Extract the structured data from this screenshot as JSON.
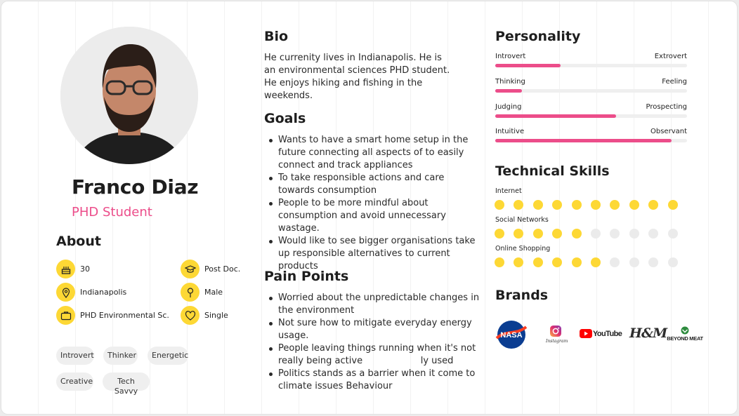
{
  "profile": {
    "name": "Franco Diaz",
    "role": "PHD Student"
  },
  "about": {
    "title": "About",
    "items": [
      {
        "icon": "cake-icon",
        "label": "30"
      },
      {
        "icon": "graduation-cap-icon",
        "label": "Post Doc."
      },
      {
        "icon": "location-pin-icon",
        "label": "Indianapolis"
      },
      {
        "icon": "male-icon",
        "label": "Male"
      },
      {
        "icon": "briefcase-icon",
        "label": "PHD Environmental Sc."
      },
      {
        "icon": "heart-icon",
        "label": "Single"
      }
    ],
    "tags": [
      "Introvert",
      "Thinker",
      "Energetic",
      "Creative",
      "Tech Savvy"
    ]
  },
  "bio": {
    "title": "Bio",
    "text": "He currenity lives in Indianapolis. He is an environmental sciences PHD student. He enjoys hiking and fishing in the weekends."
  },
  "goals": {
    "title": "Goals",
    "items": [
      "Wants to have a smart home setup in the future connecting all aspects of to easily connect and track appliances",
      "To take responsible actions and care towards consumption",
      "People to be more mindful about consumption and avoid unnecessary wastage.",
      "Would like to see bigger organisations take up responsible alternatives to current products"
    ]
  },
  "pain_points": {
    "title": "Pain Points",
    "items": [
      "Worried about the unpredictable changes in the environment",
      "Not sure how to mitigate everyday energy usage.",
      "People leaving things running when it's not really being active                    ly used",
      "Politics stands as a barrier when it come to climate issues Behaviour"
    ]
  },
  "personality": {
    "title": "Personality",
    "traits": [
      {
        "left": "Introvert",
        "right": "Extrovert",
        "value": 0.34
      },
      {
        "left": "Thinking",
        "right": "Feeling",
        "value": 0.14
      },
      {
        "left": "Judging",
        "right": "Prospecting",
        "value": 0.63
      },
      {
        "left": "Intuitive",
        "right": "Observant",
        "value": 0.92
      }
    ]
  },
  "skills": {
    "title": "Technical Skills",
    "max": 10,
    "items": [
      {
        "label": "Internet",
        "level": 10
      },
      {
        "label": "Social Networks",
        "level": 5
      },
      {
        "label": "Online Shopping",
        "level": 6
      }
    ]
  },
  "brands": {
    "title": "Brands",
    "logos": [
      {
        "name": "nasa-logo",
        "text": "NASA"
      },
      {
        "name": "instagram-logo",
        "text": "Instagram"
      },
      {
        "name": "youtube-logo",
        "text": "YouTube"
      },
      {
        "name": "hm-logo",
        "text": "H&M"
      },
      {
        "name": "beyond-meat-logo",
        "text": "BEYOND MEAT"
      }
    ]
  },
  "colors": {
    "accent": "#ec4d8a",
    "icon_bg": "#fdd835",
    "track": "#efefef"
  }
}
